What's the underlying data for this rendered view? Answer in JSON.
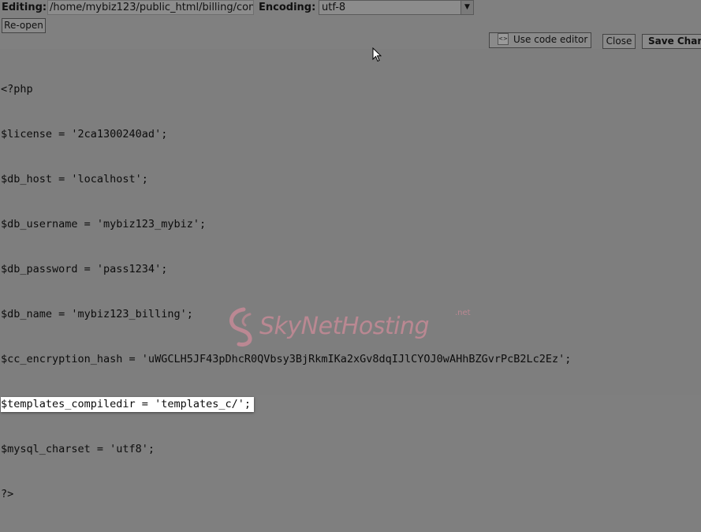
{
  "toolbar": {
    "editing_label": "Editing:",
    "file_path": "/home/mybiz123/public_html/billing/con",
    "encoding_label": "Encoding:",
    "encoding_value": "utf-8",
    "reopen_label": "Re-open",
    "code_editor_label": "Use code editor",
    "close_label": "Close",
    "save_label": "Save Chan"
  },
  "code_lines": [
    "<?php",
    "$license = '2ca1300240ad';",
    "$db_host = 'localhost';",
    "$db_username = 'mybiz123_mybiz';",
    "$db_password = 'pass1234';",
    "$db_name = 'mybiz123_billing';",
    "$cc_encryption_hash = 'uWGCLH5JF43pDhcR0QVbsy3BjRkmIKa2xGv8dqIJlCYOJ0wAHhBZGvrPcB2Lc2Ez';",
    "$templates_compiledir = 'templates_c/';",
    "$mysql_charset = 'utf8';",
    "?>"
  ],
  "highlighted_line": 7,
  "watermark": {
    "text": "SkyNetHosting",
    "suffix": ".net",
    "color": "#c58a96"
  },
  "colors": {
    "background": "#7f7f7f",
    "highlight": "#ffffff"
  }
}
